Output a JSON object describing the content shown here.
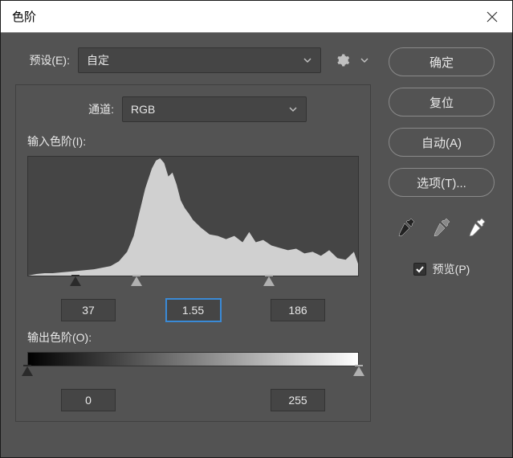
{
  "title": "色阶",
  "preset": {
    "label": "预设(E):",
    "value": "自定"
  },
  "channel": {
    "label": "通道:",
    "value": "RGB"
  },
  "input_levels": {
    "label": "输入色阶(I):",
    "black": "37",
    "gamma": "1.55",
    "white": "186"
  },
  "output_levels": {
    "label": "输出色阶(O):",
    "black": "0",
    "white": "255"
  },
  "buttons": {
    "ok": "确定",
    "reset": "复位",
    "auto": "自动(A)",
    "options": "选项(T)..."
  },
  "preview": {
    "label": "预览(P)",
    "checked": true
  },
  "colors": {
    "accent": "#3a8ad6"
  },
  "slider_positions": {
    "input_black_pct": 14.5,
    "input_gamma_pct": 33,
    "input_white_pct": 73,
    "output_black_pct": 0,
    "output_white_pct": 100
  }
}
